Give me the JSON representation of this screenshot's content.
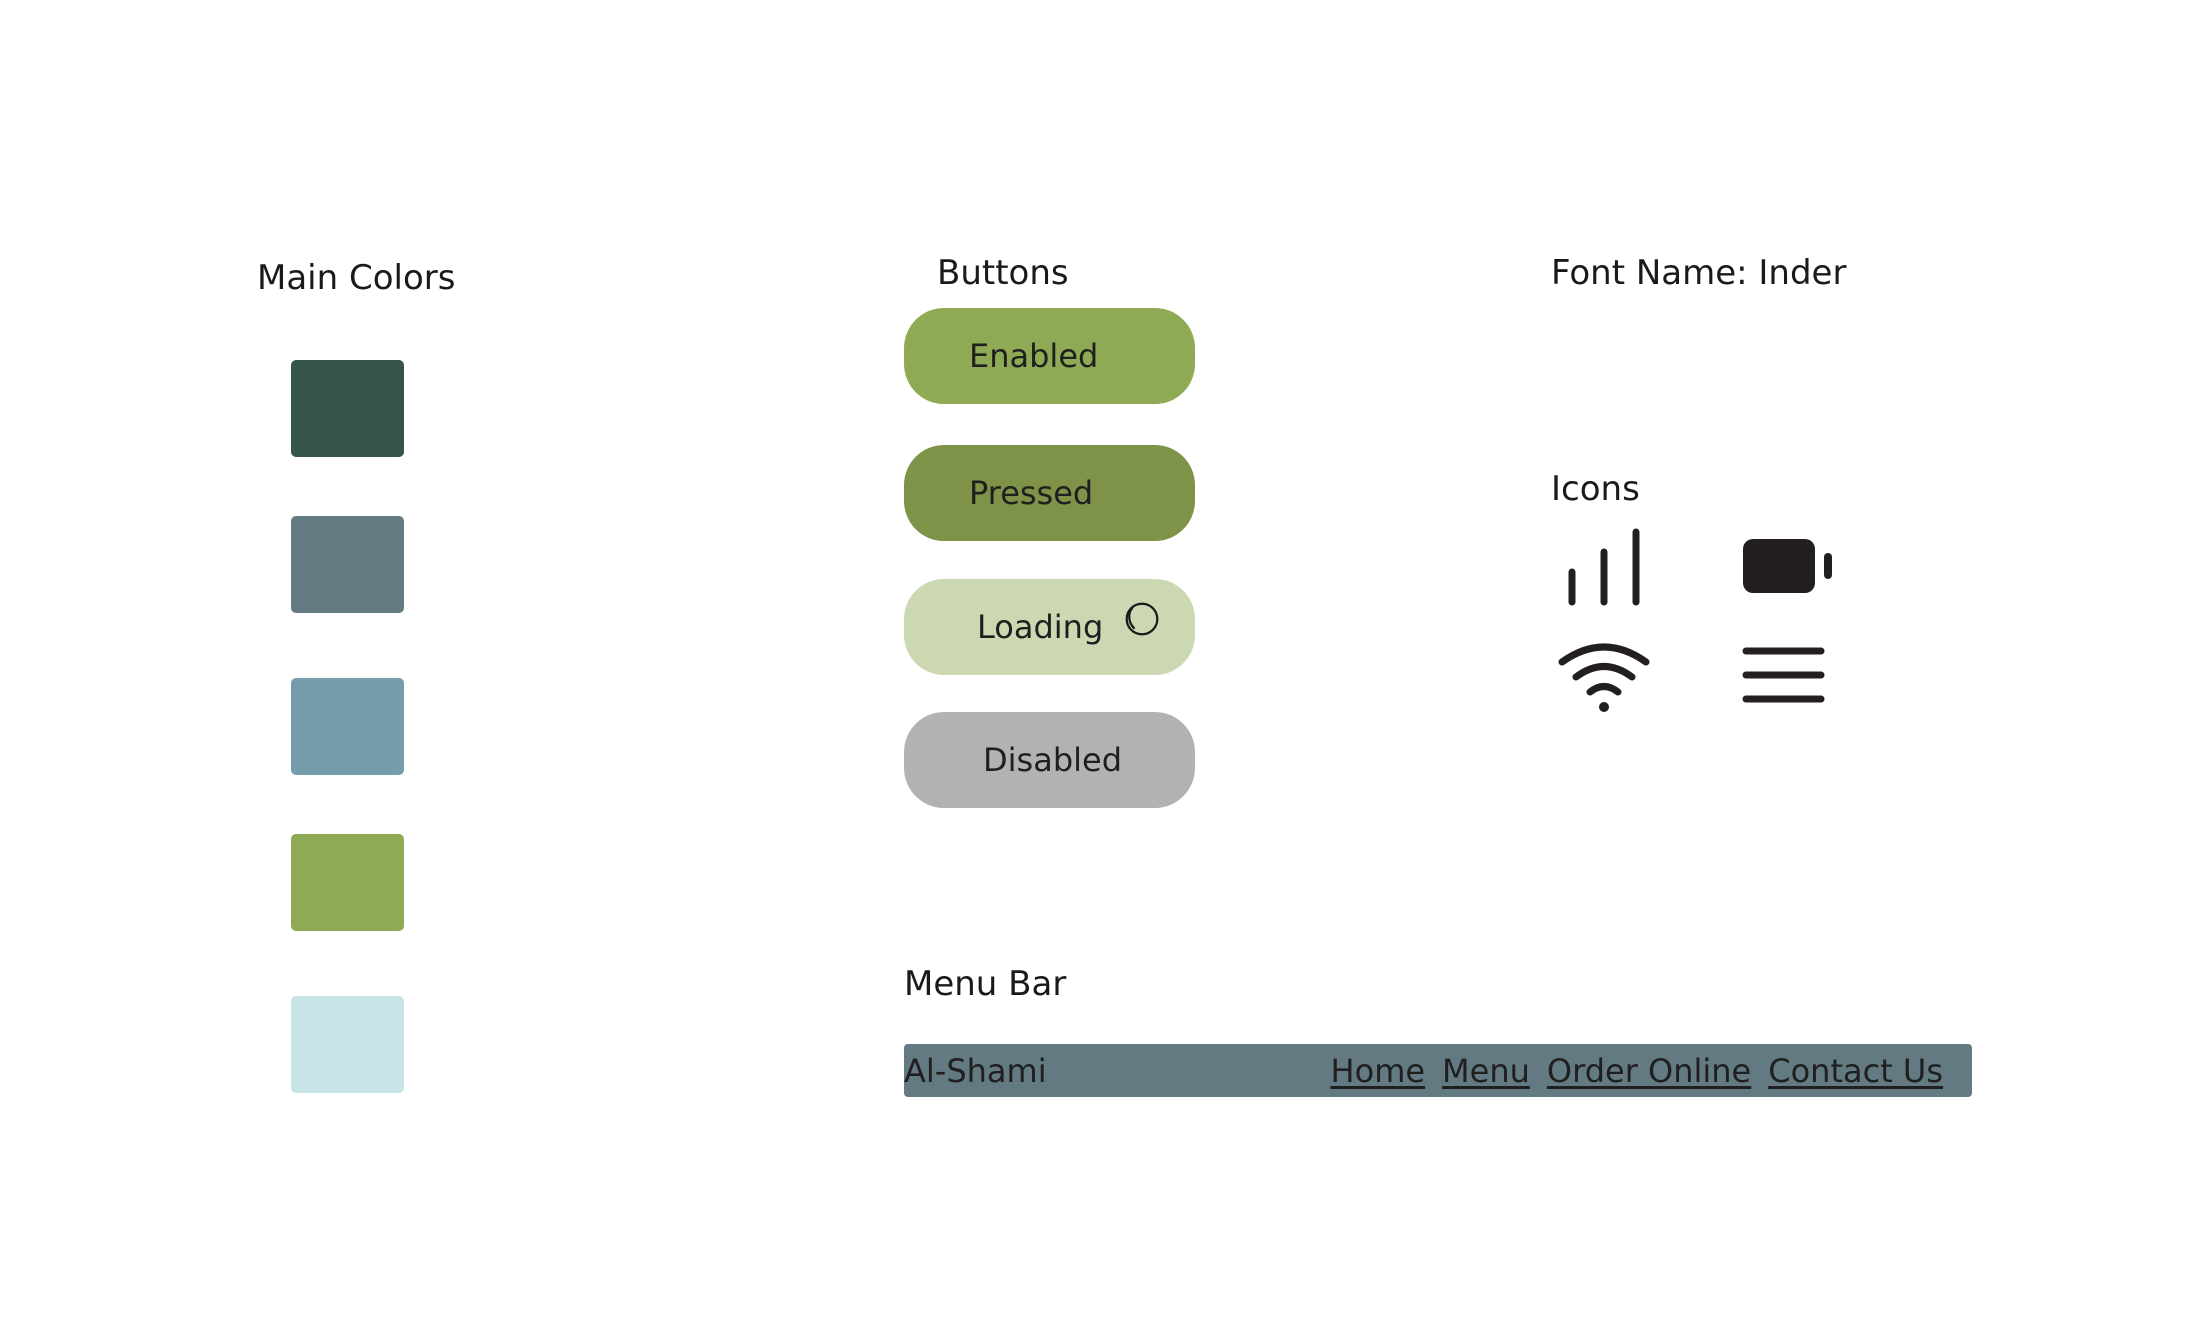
{
  "colors_section": {
    "title": "Main Colors",
    "swatches": [
      "#36534C",
      "#637A82",
      "#769DAC",
      "#8FAA54",
      "#C8E3E6"
    ]
  },
  "buttons_section": {
    "title": "Buttons",
    "enabled": {
      "label": "Enabled",
      "color": "#8FAA54"
    },
    "pressed": {
      "label": "Pressed",
      "color": "#7E9248"
    },
    "loading": {
      "label": "Loading",
      "color": "#CCD8B2",
      "icon": "spinner-icon"
    },
    "disabled": {
      "label": "Disabled",
      "color": "#B2B2B2"
    }
  },
  "font_section": {
    "title": "Font Name: Inder"
  },
  "icons_section": {
    "title": "Icons",
    "icons": [
      "signal-bars-icon",
      "battery-icon",
      "wifi-icon",
      "hamburger-menu-icon"
    ],
    "icon_color": "#231F20"
  },
  "menubar_section": {
    "title": "Menu Bar",
    "background": "#637A82",
    "brand": "Al-Shami",
    "links": [
      "Home",
      "Menu",
      "Order Online",
      "Contact Us"
    ]
  }
}
